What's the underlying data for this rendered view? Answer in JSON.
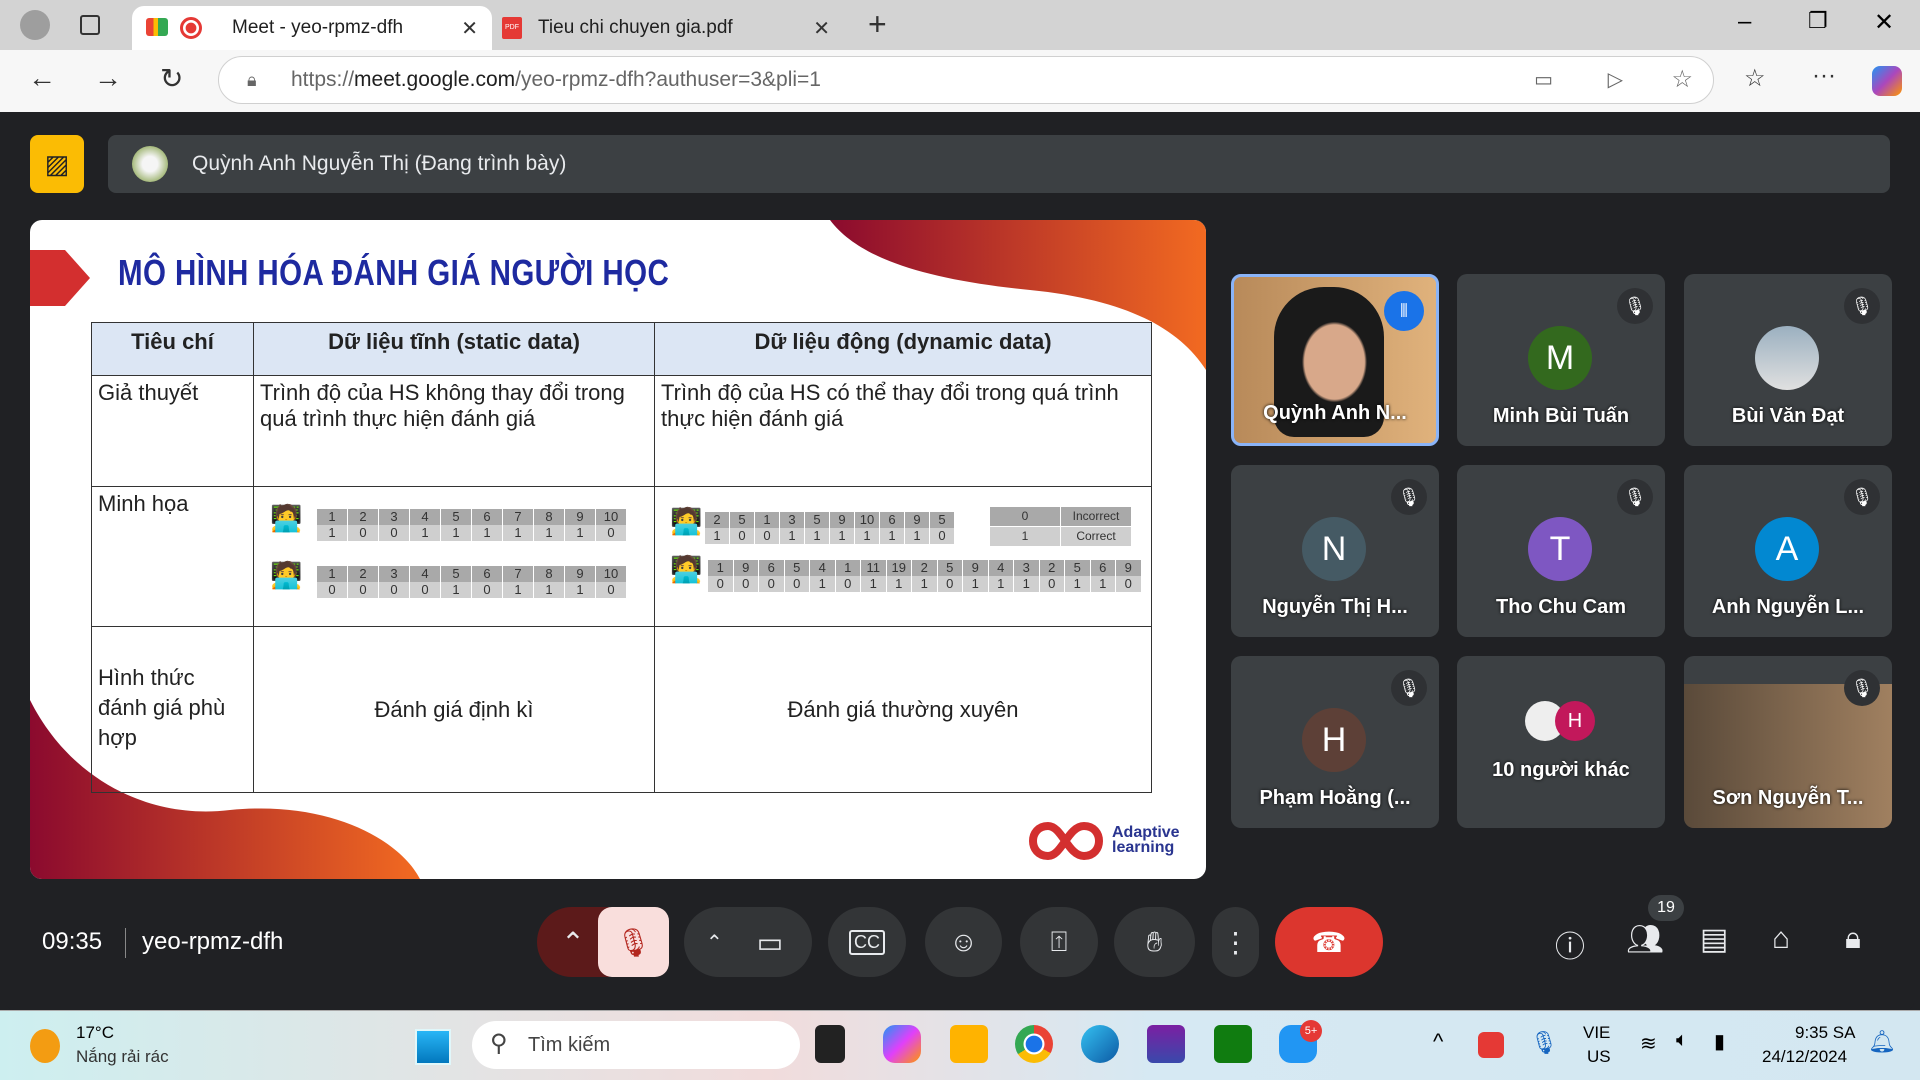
{
  "browser": {
    "tabs": [
      {
        "label": "Meet - yeo-rpmz-dfh",
        "icon": "google-meet-icon",
        "recording": true
      },
      {
        "label": "Tieu chi chuyen gia.pdf",
        "icon": "pdf-icon"
      }
    ],
    "url_prefix": "https://",
    "url_host": "meet.google.com",
    "url_path": "/yeo-rpmz-dfh?authuser=3&pli=1"
  },
  "presenter": {
    "label": "Quỳnh Anh Nguyễn Thị (Đang trình bày)"
  },
  "slide": {
    "title": "MÔ HÌNH HÓA ĐÁNH GIÁ NGƯỜI HỌC",
    "headers": [
      "Tiêu chí",
      "Dữ liệu tĩnh (static data)",
      "Dữ liệu động (dynamic data)"
    ],
    "rows": [
      {
        "label": "Giả thuyết",
        "static": "Trình độ của HS không thay đổi trong quá trình thực hiện đánh giá",
        "dynamic": "Trình độ của HS có thể thay đổi trong quá trình thực hiện đánh giá"
      },
      {
        "label": "Minh họa"
      },
      {
        "label": "Hình thức đánh giá phù hợp",
        "static": "Đánh giá định kì",
        "dynamic": "Đánh giá thường xuyên"
      }
    ],
    "static_illustration": [
      {
        "items": [
          "1",
          "2",
          "3",
          "4",
          "5",
          "6",
          "7",
          "8",
          "9",
          "10"
        ],
        "results": [
          "1",
          "0",
          "0",
          "1",
          "1",
          "1",
          "1",
          "1",
          "1",
          "0"
        ]
      },
      {
        "items": [
          "1",
          "2",
          "3",
          "4",
          "5",
          "6",
          "7",
          "8",
          "9",
          "10"
        ],
        "results": [
          "0",
          "0",
          "0",
          "0",
          "1",
          "0",
          "1",
          "1",
          "1",
          "0"
        ]
      }
    ],
    "dynamic_illustration": [
      {
        "items": [
          "2",
          "5",
          "1",
          "3",
          "5",
          "9",
          "10",
          "6",
          "9",
          "5"
        ],
        "results": [
          "1",
          "0",
          "0",
          "1",
          "1",
          "1",
          "1",
          "1",
          "1",
          "0"
        ]
      },
      {
        "items": [
          "1",
          "9",
          "6",
          "5",
          "4",
          "1",
          "11",
          "19",
          "2",
          "5",
          "9",
          "4",
          "3",
          "2",
          "5",
          "6",
          "9"
        ],
        "results": [
          "0",
          "0",
          "0",
          "0",
          "1",
          "0",
          "1",
          "1",
          "1",
          "0",
          "1",
          "1",
          "1",
          "0",
          "1",
          "1",
          "0"
        ]
      }
    ],
    "legend": [
      {
        "value": "0",
        "label": "Incorrect"
      },
      {
        "value": "1",
        "label": "Correct"
      }
    ],
    "logo_text": "Adaptive learning"
  },
  "participants": [
    {
      "name": "Quỳnh Anh N...",
      "video": true,
      "speaking": true
    },
    {
      "name": "Minh Bùi Tuấn",
      "initial": "M",
      "color": "#33691e",
      "muted": true
    },
    {
      "name": "Bùi Văn Đạt",
      "photo": true,
      "muted": true
    },
    {
      "name": "Nguyễn Thị H...",
      "initial": "N",
      "color": "#455a64",
      "muted": true
    },
    {
      "name": "Tho Chu Cam",
      "initial": "T",
      "color": "#7e57c2",
      "muted": true
    },
    {
      "name": "Anh Nguyễn L...",
      "initial": "A",
      "color": "#0288d1",
      "muted": true
    },
    {
      "name": "Phạm Hoằng (...",
      "initial": "H",
      "color": "#5d4037",
      "muted": true
    },
    {
      "name": "10 người khác",
      "initial": "H",
      "color": "#c2185b"
    },
    {
      "name": "Sơn Nguyễn T...",
      "video": true,
      "muted": true
    }
  ],
  "controls": {
    "time": "09:35",
    "meeting_code": "yeo-rpmz-dfh",
    "participant_count": "19"
  },
  "taskbar": {
    "weather_temp": "17°C",
    "weather_desc": "Nắng rải rác",
    "search_placeholder": "Tìm kiếm",
    "zalo_badge": "5+",
    "lang1": "VIE",
    "lang2": "US",
    "clock_time": "9:35 SA",
    "clock_date": "24/12/2024"
  }
}
